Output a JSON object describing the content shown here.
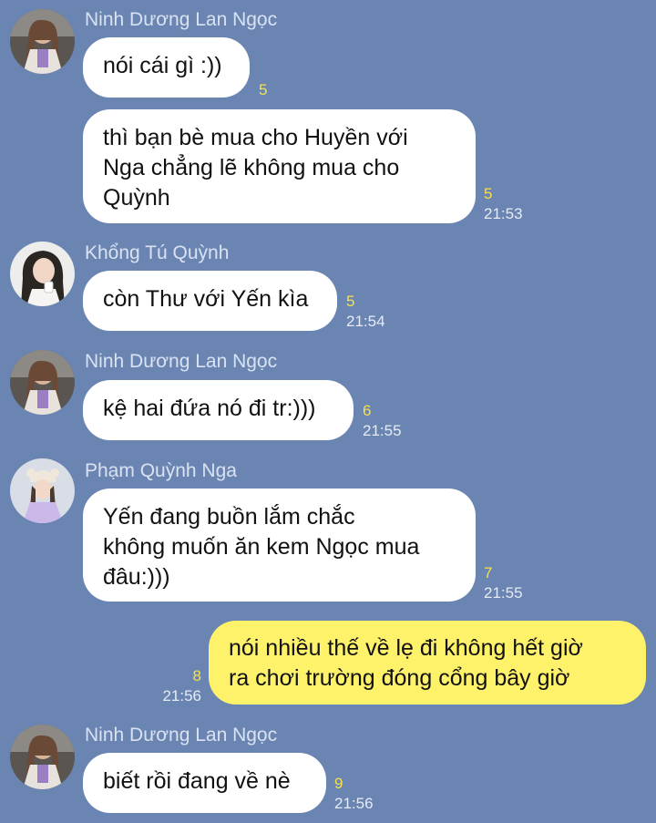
{
  "messages": [
    {
      "sender": "Ninh Dương Lan Ngọc",
      "text": "nói cái gì :))",
      "read_count": "5",
      "time": ""
    },
    {
      "sender": "",
      "text": "thì bạn bè mua cho Huyền với\nNga chẳng lẽ không mua cho\nQuỳnh",
      "read_count": "5",
      "time": "21:53"
    },
    {
      "sender": "Khổng Tú Quỳnh",
      "text": "còn Thư với Yến kìa",
      "read_count": "5",
      "time": "21:54"
    },
    {
      "sender": "Ninh Dương Lan Ngọc",
      "text": "kệ hai đứa nó đi tr:)))",
      "read_count": "6",
      "time": "21:55"
    },
    {
      "sender": "Phạm Quỳnh Nga",
      "text": "Yến đang buồn lắm chắc\nkhông muốn ăn kem Ngọc mua\nđâu:)))",
      "read_count": "7",
      "time": "21:55"
    },
    {
      "sender": "",
      "text": "nói nhiều thế về lẹ đi không hết giờ\nra chơi trường đóng cổng bây giờ",
      "read_count": "8",
      "time": "21:56"
    },
    {
      "sender": "Ninh Dương Lan Ngọc",
      "text": "biết rồi đang về nè",
      "read_count": "9",
      "time": "21:56"
    }
  ],
  "colors": {
    "background": "#6b85b3",
    "incoming_bubble": "#ffffff",
    "outgoing_bubble": "#fff26b",
    "read_count": "#f5e14a"
  },
  "icons": [
    "avatar-ngoc",
    "avatar-quynh",
    "avatar-nga"
  ]
}
